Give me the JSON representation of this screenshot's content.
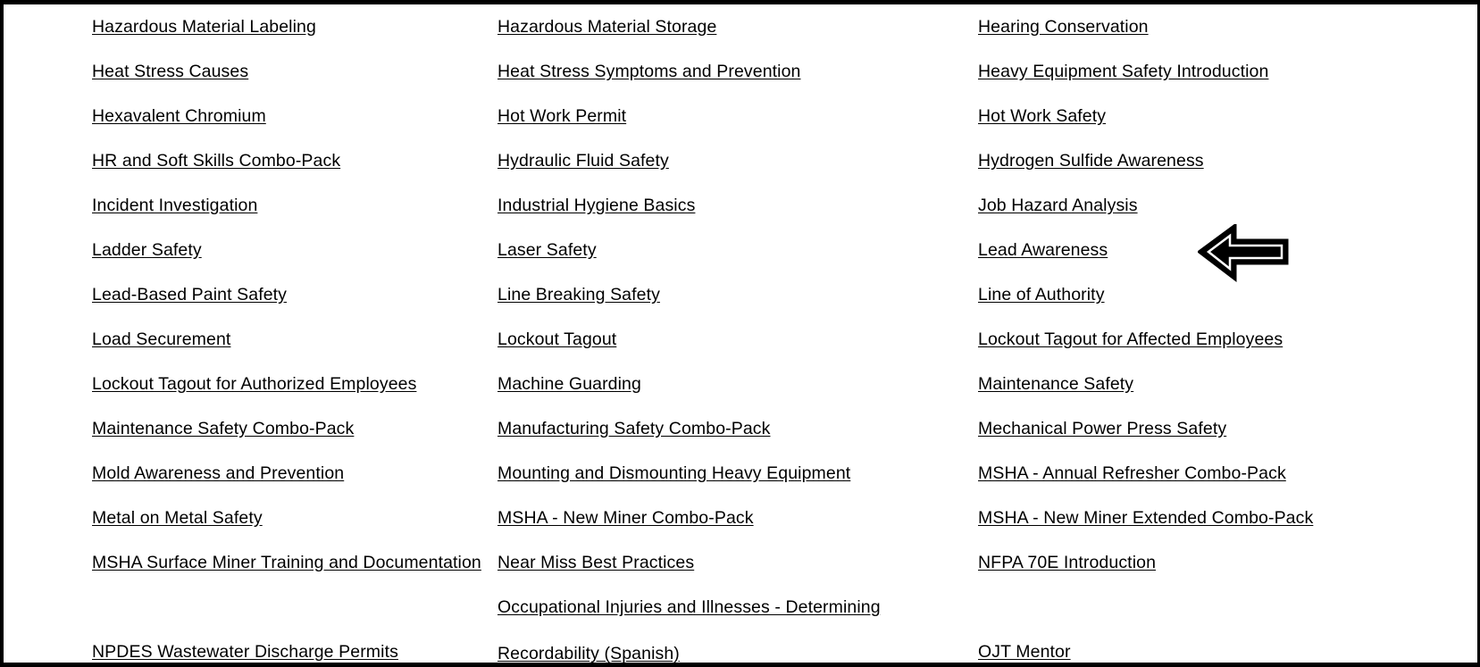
{
  "page": {
    "title": "Course Catalog Link List",
    "background_color": "#ffffff",
    "text_color": "#000000",
    "border_color": "#000000",
    "link_style": "underlined"
  },
  "annotation": {
    "type": "block-arrow",
    "direction": "left",
    "color": "#000000",
    "points_at": "Lead Awareness"
  },
  "columns": [
    {
      "id": "column-1",
      "items": [
        {
          "label": "Hazardous Material Labeling"
        },
        {
          "label": "Heat Stress Causes"
        },
        {
          "label": "Hexavalent Chromium"
        },
        {
          "label": "HR and Soft Skills Combo-Pack"
        },
        {
          "label": "Incident Investigation"
        },
        {
          "label": "Ladder Safety"
        },
        {
          "label": "Lead-Based Paint Safety"
        },
        {
          "label": "Load Securement"
        },
        {
          "label": "Lockout Tagout for Authorized Employees"
        },
        {
          "label": "Maintenance Safety Combo-Pack"
        },
        {
          "label": "Mold Awareness and Prevention"
        },
        {
          "label": "Metal on Metal Safety"
        },
        {
          "label": "MSHA Surface Miner Training and Documentation"
        },
        {
          "label": ""
        },
        {
          "label": "NPDES Wastewater Discharge Permits"
        }
      ]
    },
    {
      "id": "column-2",
      "items": [
        {
          "label": "Hazardous Material Storage"
        },
        {
          "label": "Heat Stress Symptoms and Prevention"
        },
        {
          "label": "Hot Work Permit"
        },
        {
          "label": "Hydraulic Fluid Safety"
        },
        {
          "label": "Industrial Hygiene Basics"
        },
        {
          "label": "Laser Safety"
        },
        {
          "label": "Line Breaking Safety"
        },
        {
          "label": "Lockout Tagout"
        },
        {
          "label": "Machine Guarding"
        },
        {
          "label": "Manufacturing Safety Combo-Pack"
        },
        {
          "label": "Mounting and Dismounting Heavy Equipment"
        },
        {
          "label": "MSHA - New Miner Combo-Pack"
        },
        {
          "label": "Near Miss Best Practices"
        },
        {
          "label": "Occupational Injuries and Illnesses - Determining Recordability (Spanish)",
          "wraps": true
        }
      ]
    },
    {
      "id": "column-3",
      "items": [
        {
          "label": "Hearing Conservation"
        },
        {
          "label": "Heavy Equipment Safety Introduction"
        },
        {
          "label": "Hot Work Safety"
        },
        {
          "label": "Hydrogen Sulfide Awareness"
        },
        {
          "label": "Job Hazard Analysis"
        },
        {
          "label": "Lead Awareness",
          "highlighted": true
        },
        {
          "label": "Line of Authority"
        },
        {
          "label": "Lockout Tagout for Affected Employees"
        },
        {
          "label": "Maintenance Safety"
        },
        {
          "label": "Mechanical Power Press Safety"
        },
        {
          "label": "MSHA - Annual Refresher Combo-Pack"
        },
        {
          "label": "MSHA - New Miner Extended Combo-Pack"
        },
        {
          "label": "NFPA 70E Introduction"
        },
        {
          "label": ""
        },
        {
          "label": "OJT Mentor"
        }
      ]
    }
  ]
}
